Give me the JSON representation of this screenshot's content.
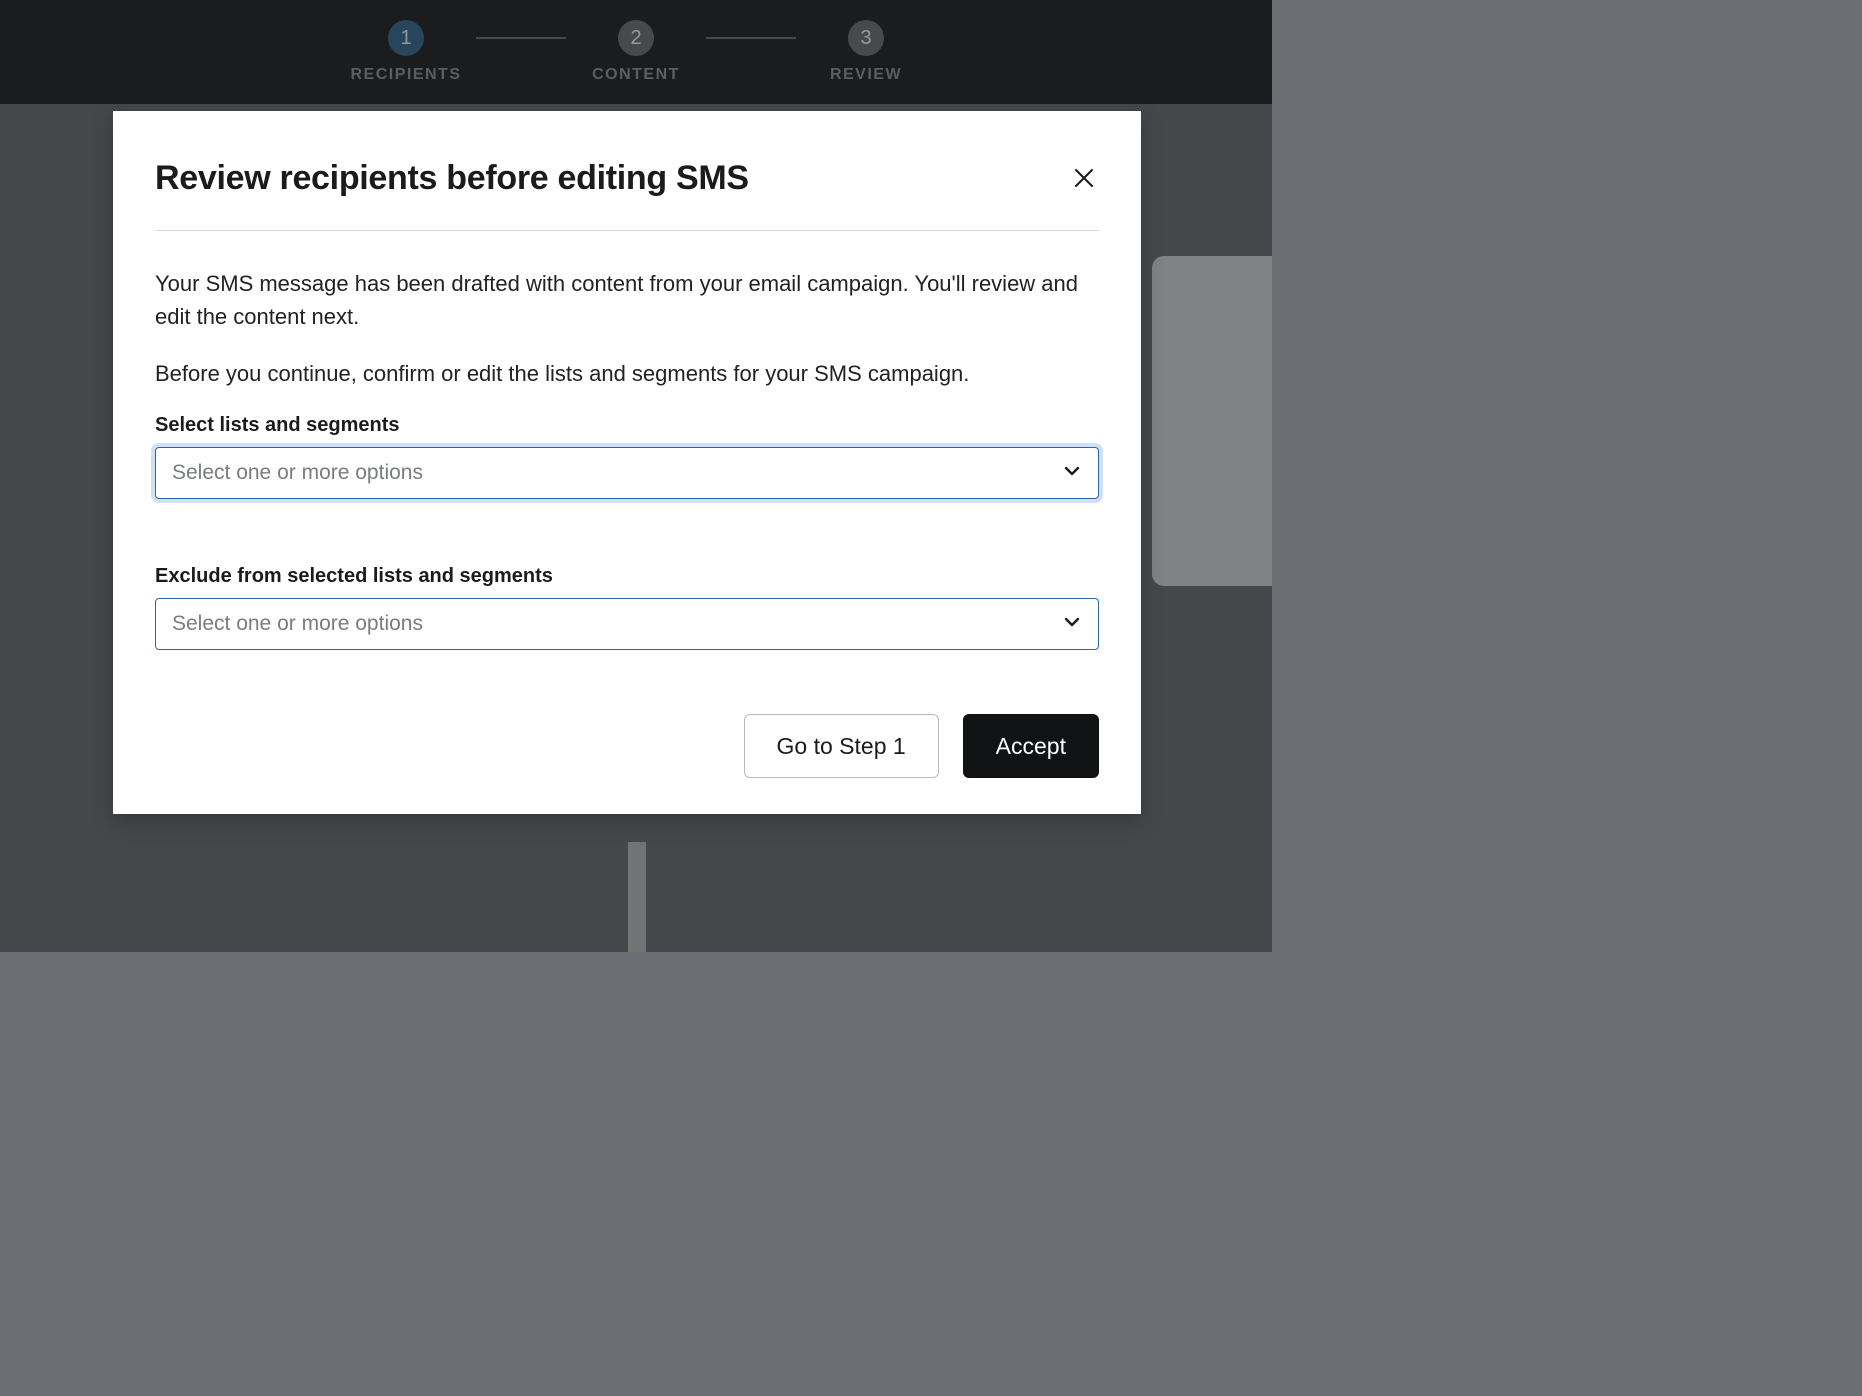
{
  "stepper": {
    "steps": [
      {
        "num": "1",
        "label": "RECIPIENTS"
      },
      {
        "num": "2",
        "label": "CONTENT"
      },
      {
        "num": "3",
        "label": "REVIEW"
      }
    ]
  },
  "modal": {
    "title": "Review recipients before editing SMS",
    "paragraph1": "Your SMS message has been drafted with content from your email campaign. You'll review and edit the content next.",
    "paragraph2": "Before you continue, confirm or edit the lists and segments for your SMS campaign.",
    "fields": {
      "include": {
        "label": "Select lists and segments",
        "placeholder": "Select one or more options"
      },
      "exclude": {
        "label": "Exclude from selected lists and segments",
        "placeholder": "Select one or more options"
      }
    },
    "buttons": {
      "back": "Go to Step 1",
      "accept": "Accept"
    }
  }
}
